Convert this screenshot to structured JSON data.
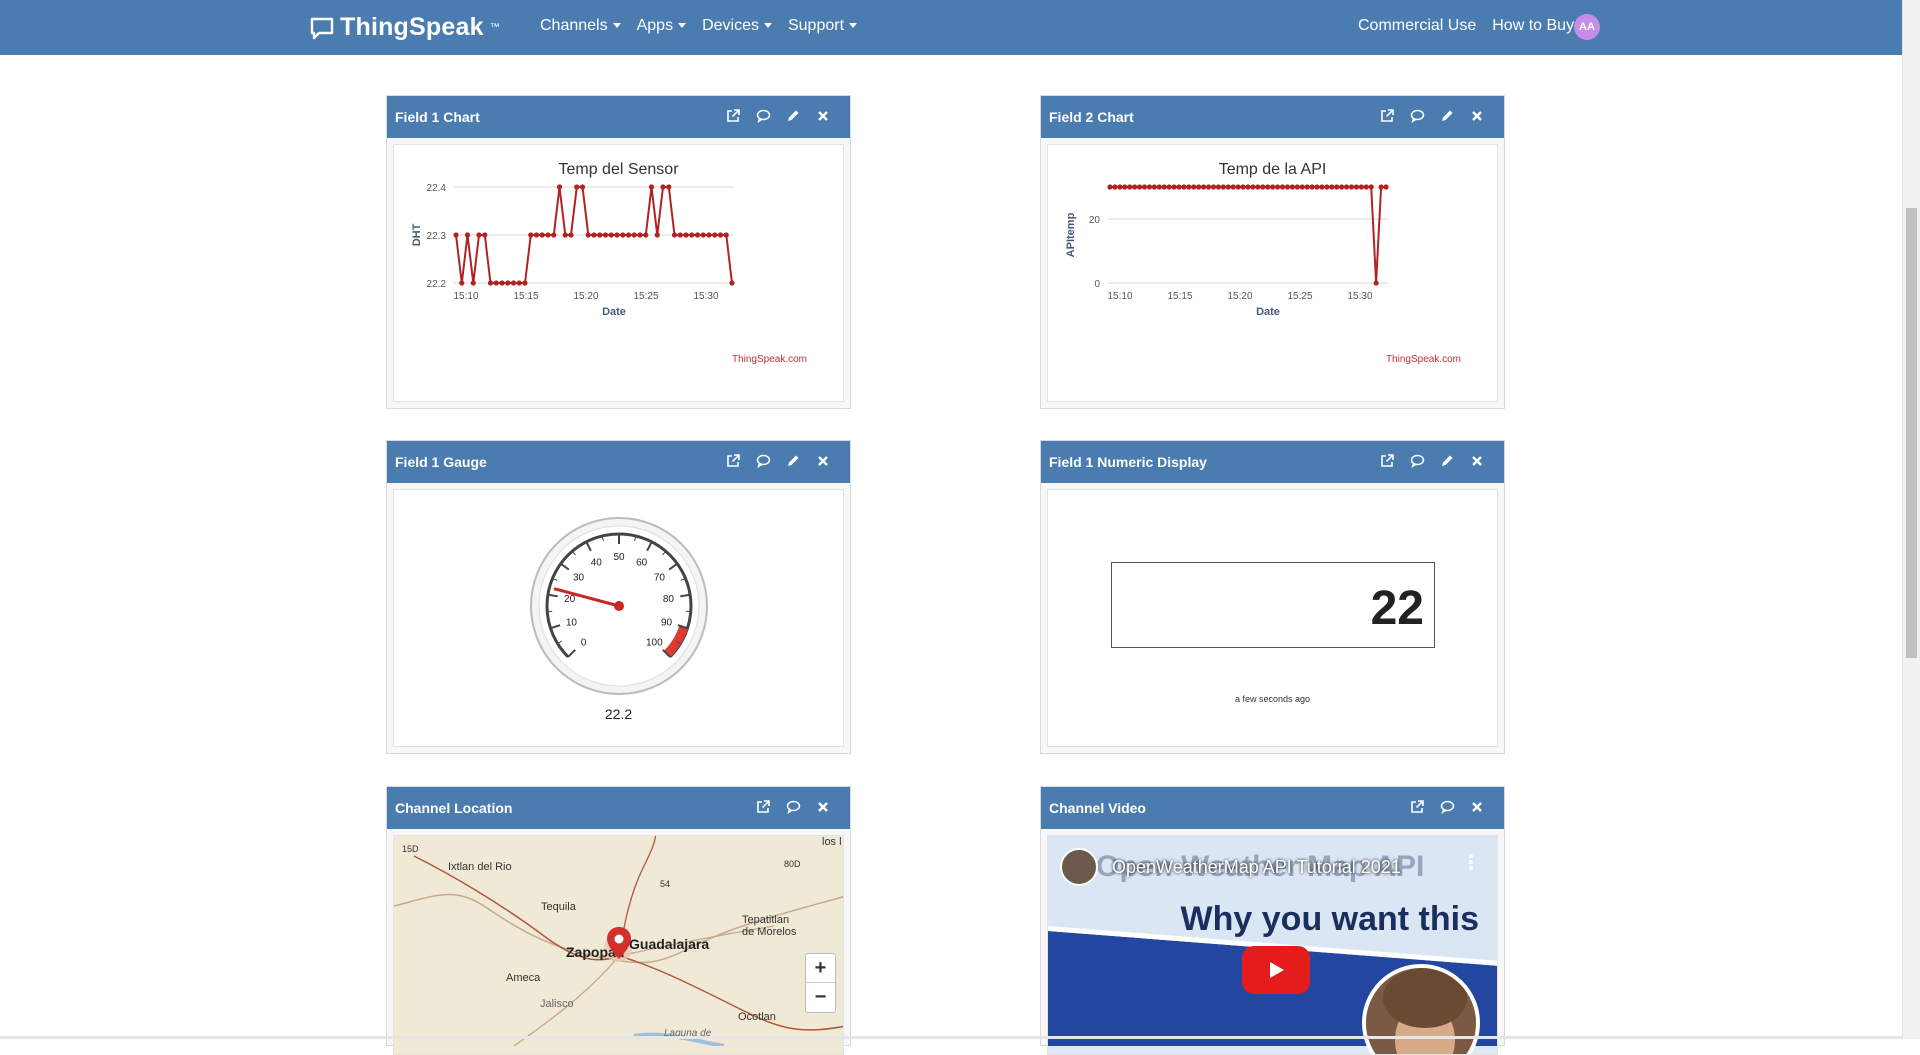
{
  "nav": {
    "brand": "ThingSpeak",
    "brand_tm": "™",
    "menus": [
      "Channels",
      "Apps",
      "Devices",
      "Support"
    ],
    "right_links": [
      "Commercial Use",
      "How to Buy"
    ],
    "avatar_initials": "AA"
  },
  "widgets": {
    "field1_chart": {
      "title": "Field 1 Chart",
      "chart_title": "Temp del Sensor",
      "footer": "ThingSpeak.com"
    },
    "field2_chart": {
      "title": "Field 2 Chart",
      "chart_title": "Temp de la API",
      "footer": "ThingSpeak.com"
    },
    "field1_gauge": {
      "title": "Field 1 Gauge",
      "value_text": "22.2",
      "ticks": [
        "0",
        "10",
        "20",
        "30",
        "40",
        "50",
        "60",
        "70",
        "80",
        "90",
        "100"
      ]
    },
    "numeric_display": {
      "title": "Field 1 Numeric Display",
      "value": "22",
      "time": "a few seconds ago"
    },
    "channel_location": {
      "title": "Channel Location",
      "labels": [
        "Ixtlan del Rio",
        "Tequila",
        "Zapopan",
        "Guadalajara",
        "Tepatitlan de Morelos",
        "Ameca",
        "Jalisco",
        "Ocotlan",
        "Laguna de",
        "los l",
        "15D",
        "80D",
        "54"
      ],
      "zoom_in": "+",
      "zoom_out": "−"
    },
    "channel_video": {
      "title": "Channel Video",
      "video_title": "OpenWeatherMap API Tutorial 2021",
      "headline": "Why you want this",
      "ghost_text": "Open Weather Map API"
    }
  },
  "chart_data": [
    {
      "type": "line",
      "title": "Temp del Sensor",
      "xlabel": "Date",
      "ylabel": "DHT",
      "x_ticks": [
        "15:10",
        "15:15",
        "15:20",
        "15:25",
        "15:30"
      ],
      "y_ticks": [
        "22.2",
        "22.3",
        "22.4"
      ],
      "ylim": [
        22.2,
        22.4
      ],
      "xlim_minutes": [
        15.1,
        15.55
      ],
      "series": [
        {
          "name": "",
          "color": "#b22222",
          "x": [
            "15:09",
            "15:09.5",
            "15:10",
            "15:10.5",
            "15:11",
            "15:11.5",
            "15:12",
            "15:12.5",
            "15:13",
            "15:13.5",
            "15:14",
            "15:14.5",
            "15:15",
            "15:15.5",
            "15:16",
            "15:16.5",
            "15:17",
            "15:17.5",
            "15:18",
            "15:18.5",
            "15:19",
            "15:19.5",
            "15:20",
            "15:20.5",
            "15:21",
            "15:21.5",
            "15:22",
            "15:22.5",
            "15:23",
            "15:23.5",
            "15:24",
            "15:24.5",
            "15:25",
            "15:25.5",
            "15:26",
            "15:26.5",
            "15:27",
            "15:27.5",
            "15:28",
            "15:28.5",
            "15:29",
            "15:29.5",
            "15:30",
            "15:30.5",
            "15:31",
            "15:31.5",
            "15:32",
            "15:32.5",
            "15:33"
          ],
          "values": [
            22.3,
            22.2,
            22.3,
            22.2,
            22.3,
            22.3,
            22.2,
            22.2,
            22.2,
            22.2,
            22.2,
            22.2,
            22.2,
            22.3,
            22.3,
            22.3,
            22.3,
            22.3,
            22.4,
            22.3,
            22.3,
            22.4,
            22.4,
            22.3,
            22.3,
            22.3,
            22.3,
            22.3,
            22.3,
            22.3,
            22.3,
            22.3,
            22.3,
            22.3,
            22.4,
            22.3,
            22.4,
            22.4,
            22.3,
            22.3,
            22.3,
            22.3,
            22.3,
            22.3,
            22.3,
            22.3,
            22.3,
            22.3,
            22.2
          ]
        }
      ]
    },
    {
      "type": "line",
      "title": "Temp de la API",
      "xlabel": "Date",
      "ylabel": "APItemp",
      "x_ticks": [
        "15:10",
        "15:15",
        "15:20",
        "15:25",
        "15:30"
      ],
      "y_ticks": [
        "0",
        "20"
      ],
      "ylim": [
        0,
        30
      ],
      "series": [
        {
          "name": "",
          "color": "#b22222",
          "values": [
            30,
            30,
            30,
            30,
            30,
            30,
            30,
            30,
            30,
            30,
            30,
            30,
            30,
            30,
            30,
            30,
            30,
            30,
            30,
            30,
            30,
            30,
            30,
            30,
            30,
            30,
            30,
            30,
            30,
            30,
            30,
            30,
            30,
            30,
            30,
            30,
            30,
            30,
            30,
            30,
            30,
            30,
            30,
            30,
            30,
            30,
            30,
            30,
            30,
            30,
            30,
            30,
            30,
            30,
            0,
            30,
            30
          ]
        }
      ]
    },
    {
      "type": "gauge",
      "value": 22.2,
      "min": 0,
      "max": 100,
      "danger_band": [
        90,
        100
      ],
      "danger_color": "#e03a2f"
    }
  ]
}
